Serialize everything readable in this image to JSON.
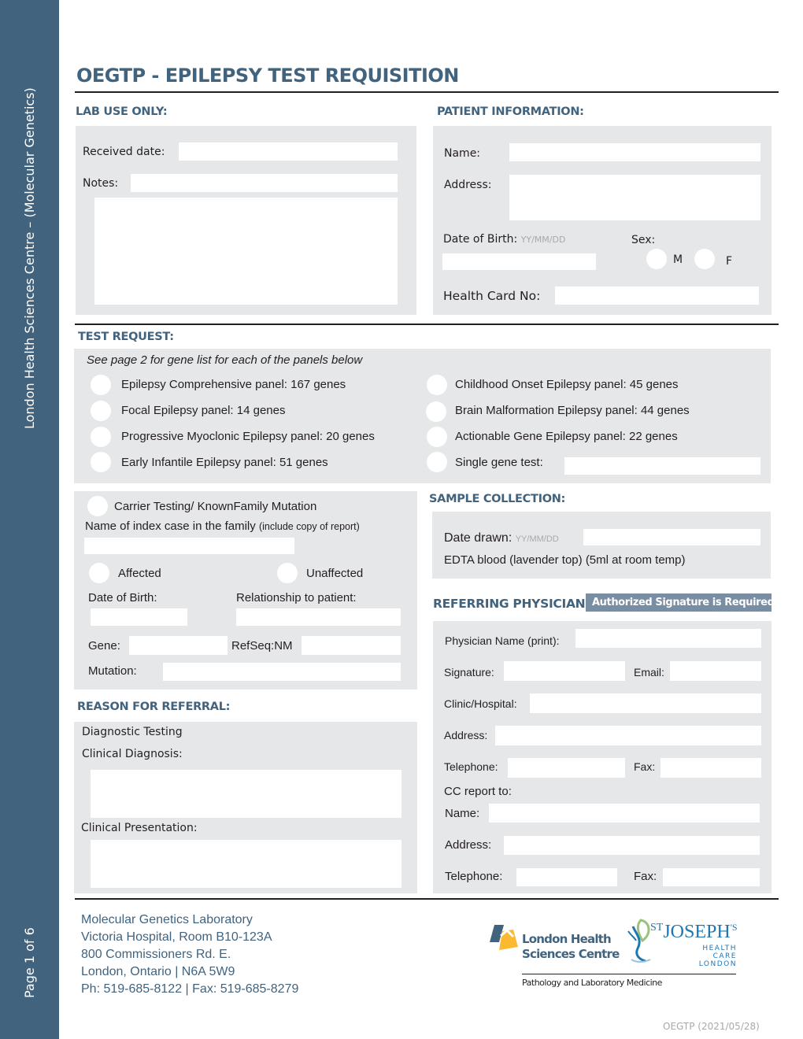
{
  "sidebar": {
    "org_text": "London Health Sciences Centre – (Molecular Genetics)",
    "page_text": "Page 1 of 6"
  },
  "title": "OEGTP - EPILEPSY TEST REQUISITION",
  "lab_use": {
    "heading": "LAB USE ONLY:",
    "received_date_label": "Received date:",
    "received_date_value": "",
    "notes_label": "Notes:",
    "notes_value": ""
  },
  "patient": {
    "heading": "PATIENT INFORMATION:",
    "name_label": "Name:",
    "address_label": "Address:",
    "dob_label": "Date of Birth:",
    "dob_hint": "YY/MM/DD",
    "sex_label": "Sex:",
    "sex_options": [
      "M",
      "F"
    ],
    "health_card_label": "Health Card No:"
  },
  "test_request": {
    "heading": "TEST REQUEST:",
    "note": "See page 2 for gene list for each of the panels below",
    "panels_left": [
      "Epilepsy Comprehensive panel: 167 genes",
      "Focal Epilepsy panel: 14 genes",
      "Progressive Myoclonic Epilepsy panel: 20 genes",
      "Early Infantile Epilepsy panel: 51 genes"
    ],
    "panels_right": [
      "Childhood Onset Epilepsy panel: 45 genes",
      "Brain Malformation Epilepsy panel: 44 genes",
      "Actionable Gene Epilepsy panel: 22 genes",
      "Single gene test:"
    ]
  },
  "carrier": {
    "option_label": "Carrier Testing/ KnownFamily Mutation",
    "index_case_label": "Name of index case in the family",
    "index_case_note": "(include copy of report)",
    "affected_label": "Affected",
    "unaffected_label": "Unaffected",
    "dob_label": "Date of Birth:",
    "relationship_label": "Relationship to patient:",
    "gene_label": "Gene:",
    "refseq_label": "RefSeq:NM",
    "mutation_label": "Mutation:"
  },
  "sample": {
    "heading": "SAMPLE COLLECTION:",
    "date_drawn_label": "Date drawn:",
    "date_hint": "YY/MM/DD",
    "specimen_text": "EDTA blood (lavender top) (5ml at room temp)"
  },
  "physician": {
    "heading": "REFERRING PHYSICIAN:",
    "badge": "Authorized Signature is Required",
    "name_label": "Physician Name (print):",
    "signature_label": "Signature:",
    "email_label": "Email:",
    "clinic_label": "Clinic/Hospital:",
    "address_label": "Address:",
    "telephone_label": "Telephone:",
    "fax_label": "Fax:",
    "cc_label": "CC report to:",
    "cc_name_label": "Name:",
    "cc_address_label": "Address:",
    "cc_telephone_label": "Telephone:",
    "cc_fax_label": "Fax:"
  },
  "referral": {
    "heading": "REASON FOR REFERRAL:",
    "diagnostic_testing": "Diagnostic Testing",
    "clinical_diagnosis_label": "Clinical Diagnosis:",
    "clinical_presentation_label": "Clinical Presentation:"
  },
  "footer": {
    "address_lines": [
      "Molecular Genetics Laboratory",
      "Victoria Hospital, Room B10-123A",
      "800 Commissioners Rd. E.",
      "London, Ontario | N6A 5W9",
      "Ph: 519-685-8122 | Fax: 519-685-8279"
    ],
    "lhsc_logo_line1": "London Health",
    "lhsc_logo_line2": "Sciences Centre",
    "sjhc_logo_main": "JOSEPH",
    "sjhc_logo_st": "ST",
    "sjhc_logo_s": "'S",
    "sjhc_logo_sub1": "HEALTH CARE",
    "sjhc_logo_sub2": "LONDON",
    "department": "Pathology and Laboratory Medicine",
    "version": "OEGTP (2021/05/28)"
  },
  "colors": {
    "brand": "#41637e",
    "panel_gray": "#e6e7e8",
    "badge": "#7a8ea3",
    "lhsc_yellow": "#fbb931"
  }
}
